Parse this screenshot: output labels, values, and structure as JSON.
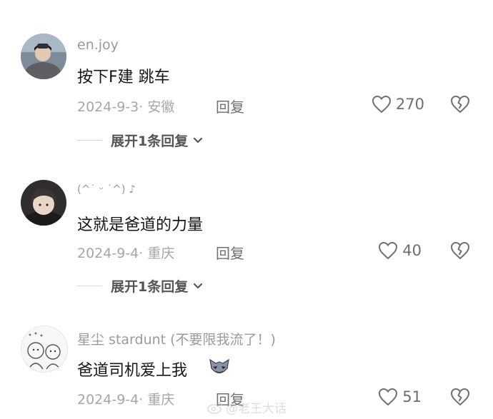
{
  "comments": [
    {
      "username": "en.joy",
      "content": "按下F建 跳车",
      "date_location": "2024-9-3· 安徽",
      "reply_label": "回复",
      "likes": "270",
      "expand_label": "展开1条回复"
    },
    {
      "username": "(^˙ ᵕ ˙^) ♪",
      "content": "这就是爸道的力量",
      "date_location": "2024-9-4· 重庆",
      "reply_label": "回复",
      "likes": "40",
      "expand_label": "展开1条回复"
    },
    {
      "username": "星尘 stardunt (不要限我流了！)",
      "content": "爸道司机爱上我",
      "date_location": "2024-9-4· 重庆",
      "reply_label": "回复",
      "likes": "51"
    }
  ],
  "watermark": {
    "text": "@老王大话"
  }
}
